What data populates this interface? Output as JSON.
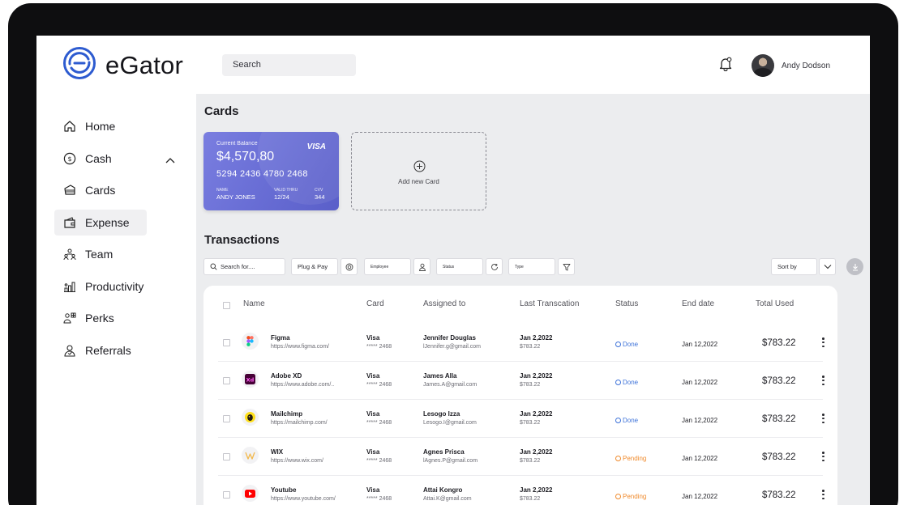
{
  "app": {
    "name": "eGator"
  },
  "header": {
    "search_placeholder": "Search",
    "user_name": "Andy Dodson"
  },
  "sidebar": {
    "items": [
      {
        "label": "Home",
        "icon": "home-icon"
      },
      {
        "label": "Cash",
        "icon": "dollar-circle-icon"
      },
      {
        "label": "Cards",
        "icon": "cards-icon"
      },
      {
        "label": "Expense",
        "icon": "wallet-icon",
        "active": true
      },
      {
        "label": "Team",
        "icon": "team-icon"
      },
      {
        "label": "Productivity",
        "icon": "productivity-icon"
      },
      {
        "label": "Perks",
        "icon": "perks-icon"
      },
      {
        "label": "Referrals",
        "icon": "referrals-icon"
      }
    ]
  },
  "cards_section": {
    "title": "Cards",
    "card": {
      "balance_label": "Current Balance",
      "balance": "$4,570,80",
      "brand": "VISA",
      "number": "5294 2436 4780 2468",
      "name_label": "NAME",
      "name": "ANDY JONES",
      "valid_label": "VALID THRU",
      "valid": "12/24",
      "cvv_label": "CVV",
      "cvv": "344"
    },
    "add_card_label": "Add new Card"
  },
  "transactions": {
    "title": "Transactions",
    "filters": {
      "search_placeholder": "Search for....",
      "plug_pay": "Plug & Pay",
      "employee": "Employee",
      "status": "Status",
      "type": "Type",
      "sort_by": "Sort by"
    },
    "columns": [
      "Name",
      "Card",
      "Assigned to",
      "Last Transcation",
      "Status",
      "End date",
      "Total Used"
    ],
    "rows": [
      {
        "name": "Figma",
        "url": "https://www.figma.com/",
        "card": "Visa",
        "card_no": "***** 2468",
        "assignee": "Jennifer Douglas",
        "email": "lJennifer.g@gmail.com",
        "last_date": "Jan 2,2022",
        "last_amount": "$783.22",
        "status": "Done",
        "end_date": "Jan 12,2022",
        "total": "$783.22",
        "icon": "figma-icon"
      },
      {
        "name": "Adobe XD",
        "url": "https://www.adobe.com/..",
        "card": "Visa",
        "card_no": "***** 2468",
        "assignee": "James Alla",
        "email": "James.A@gmail.com",
        "last_date": "Jan 2,2022",
        "last_amount": "$783.22",
        "status": "Done",
        "end_date": "Jan 12,2022",
        "total": "$783.22",
        "icon": "adobe-xd-icon"
      },
      {
        "name": "Mailchimp",
        "url": "https://mailchimp.com/",
        "card": "Visa",
        "card_no": "***** 2468",
        "assignee": "Lesogo Izza",
        "email": "Lesogo.I@gmail.com",
        "last_date": "Jan 2,2022",
        "last_amount": "$783.22",
        "status": "Done",
        "end_date": "Jan 12,2022",
        "total": "$783.22",
        "icon": "mailchimp-icon"
      },
      {
        "name": "WIX",
        "url": "https://www.wix.com/",
        "card": "Visa",
        "card_no": "***** 2468",
        "assignee": "Agnes Prisca",
        "email": "lAgnes.P@gmail.com",
        "last_date": "Jan 2,2022",
        "last_amount": "$783.22",
        "status": "Pending",
        "end_date": "Jan 12,2022",
        "total": "$783.22",
        "icon": "wix-icon"
      },
      {
        "name": "Youtube",
        "url": "https://www.youtube.com/",
        "card": "Visa",
        "card_no": "***** 2468",
        "assignee": "Attai Kongro",
        "email": "Attai.K@gmail.com",
        "last_date": "Jan 2,2022",
        "last_amount": "$783.22",
        "status": "Pending",
        "end_date": "Jan 12,2022",
        "total": "$783.22",
        "icon": "youtube-icon"
      }
    ]
  },
  "colors": {
    "done": "#3d72d9",
    "pending": "#f08a2c",
    "card_accent": "#6a6fd6",
    "main_bg": "#ecedef"
  }
}
